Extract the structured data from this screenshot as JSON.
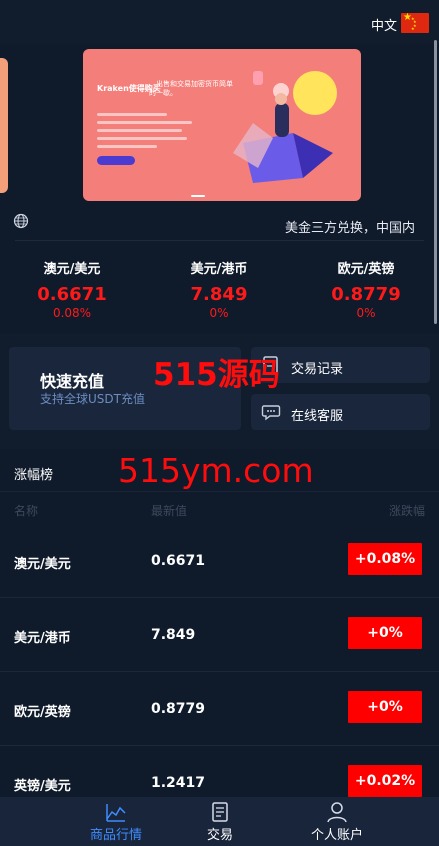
{
  "header": {
    "language": "中文"
  },
  "banner": {
    "brand": "Kraken使得购买",
    "text": "、出售和交易加密货币简单的一歇。"
  },
  "notice": {
    "text": "美金三方兑换，中国内"
  },
  "tickers": [
    {
      "pair": "澳元/美元",
      "price": "0.6671",
      "change": "0.08%"
    },
    {
      "pair": "美元/港币",
      "price": "7.849",
      "change": "0%"
    },
    {
      "pair": "欧元/英镑",
      "price": "0.8779",
      "change": "0%"
    }
  ],
  "quick": {
    "recharge_title": "快速充值",
    "recharge_sub": "支持全球USDT充值",
    "records": "交易记录",
    "service": "在线客服"
  },
  "watermarks": {
    "line1": "515源码",
    "line2": "515ym.com"
  },
  "gainers": {
    "title": "涨幅榜",
    "col_name": "名称",
    "col_price": "最新值",
    "col_change": "涨跌幅",
    "rows": [
      {
        "name": "澳元/美元",
        "value": "0.6671",
        "change": "+0.08%"
      },
      {
        "name": "美元/港币",
        "value": "7.849",
        "change": "+0%"
      },
      {
        "name": "欧元/英镑",
        "value": "0.8779",
        "change": "+0%"
      },
      {
        "name": "英镑/美元",
        "value": "1.2417",
        "change": "+0.02%"
      }
    ]
  },
  "nav": {
    "market": "商品行情",
    "trade": "交易",
    "account": "个人账户"
  },
  "colors": {
    "accent_blue": "#3f8cff",
    "up_red": "#ff1a1a",
    "background": "#0f1a2b"
  }
}
